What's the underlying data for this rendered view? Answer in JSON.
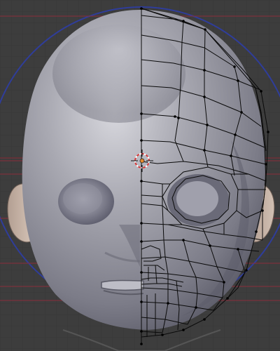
{
  "viewport": {
    "name": "3D Viewport",
    "view": "front-orthographic",
    "mode": "edit-mode-wireframe-overlay"
  },
  "colors": {
    "background": "#3d3d3d",
    "grid": "#363636",
    "reference_circle": "#2f3d9a",
    "red_guide": "#8a2d3a",
    "mesh_surface": "#9a9aa4",
    "ear": "#c8b3a4",
    "wire": "#0a0a0a",
    "cursor_red": "#ffffff",
    "cursor_orange": "#e38a2e"
  },
  "icons": {
    "cursor": "3d-cursor-icon"
  }
}
